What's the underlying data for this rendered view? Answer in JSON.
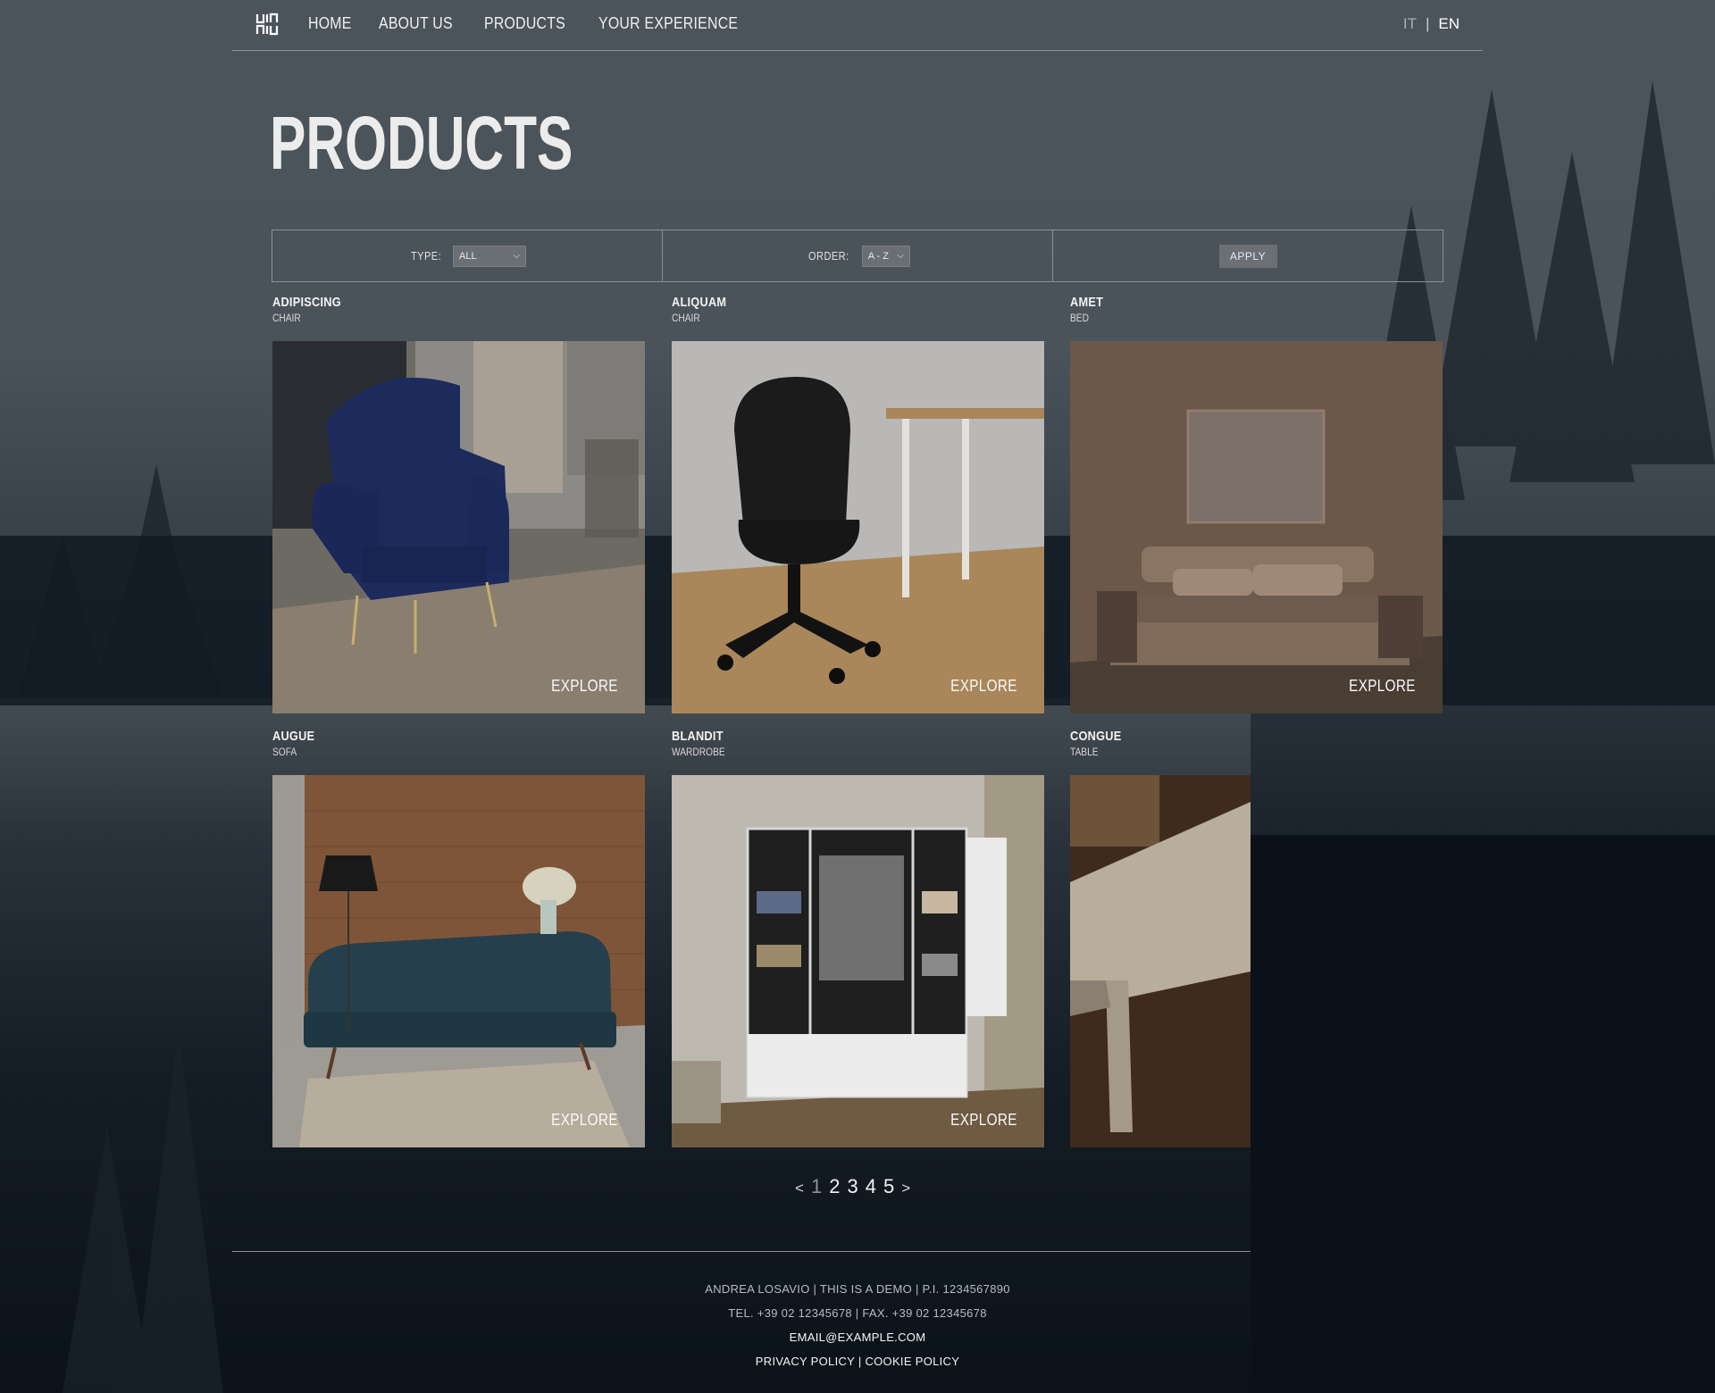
{
  "nav": {
    "logo_alt": "Logo",
    "links": [
      "HOME",
      "ABOUT US",
      "PRODUCTS",
      "YOUR EXPERIENCE"
    ],
    "lang_it": "IT",
    "lang_sep": "|",
    "lang_en": "EN"
  },
  "page_title": "PRODUCTS",
  "filters": {
    "type_label": "TYPE:",
    "type_value": "ALL",
    "order_label": "ORDER:",
    "order_value": "A - Z",
    "apply_label": "APPLY"
  },
  "products": [
    {
      "name": "ADIPISCING",
      "type": "CHAIR",
      "explore": "EXPLORE"
    },
    {
      "name": "ALIQUAM",
      "type": "CHAIR",
      "explore": "EXPLORE"
    },
    {
      "name": "AMET",
      "type": "BED",
      "explore": "EXPLORE"
    },
    {
      "name": "AUGUE",
      "type": "SOFA",
      "explore": "EXPLORE"
    },
    {
      "name": "BLANDIT",
      "type": "WARDROBE",
      "explore": "EXPLORE"
    },
    {
      "name": "CONGUE",
      "type": "TABLE",
      "explore": ""
    }
  ],
  "pagination": {
    "prev": "<",
    "pages": [
      "1",
      "2",
      "3",
      "4",
      "5"
    ],
    "current": "1",
    "next": ">"
  },
  "footer": {
    "line1": "ANDREA LOSAVIO | THIS IS A DEMO | P.I. 1234567890",
    "line2": "TEL. +39 02 12345678 | FAX. +39 02 12345678",
    "email": "EMAIL@EXAMPLE.COM",
    "privacy": "PRIVACY POLICY",
    "sep": "|",
    "cookie": "COOKIE POLICY"
  },
  "colors": {
    "background_top": "#4c545b",
    "background_bottom": "#0a1118",
    "rule": "#8d9398",
    "text": "#e8e8e8"
  }
}
